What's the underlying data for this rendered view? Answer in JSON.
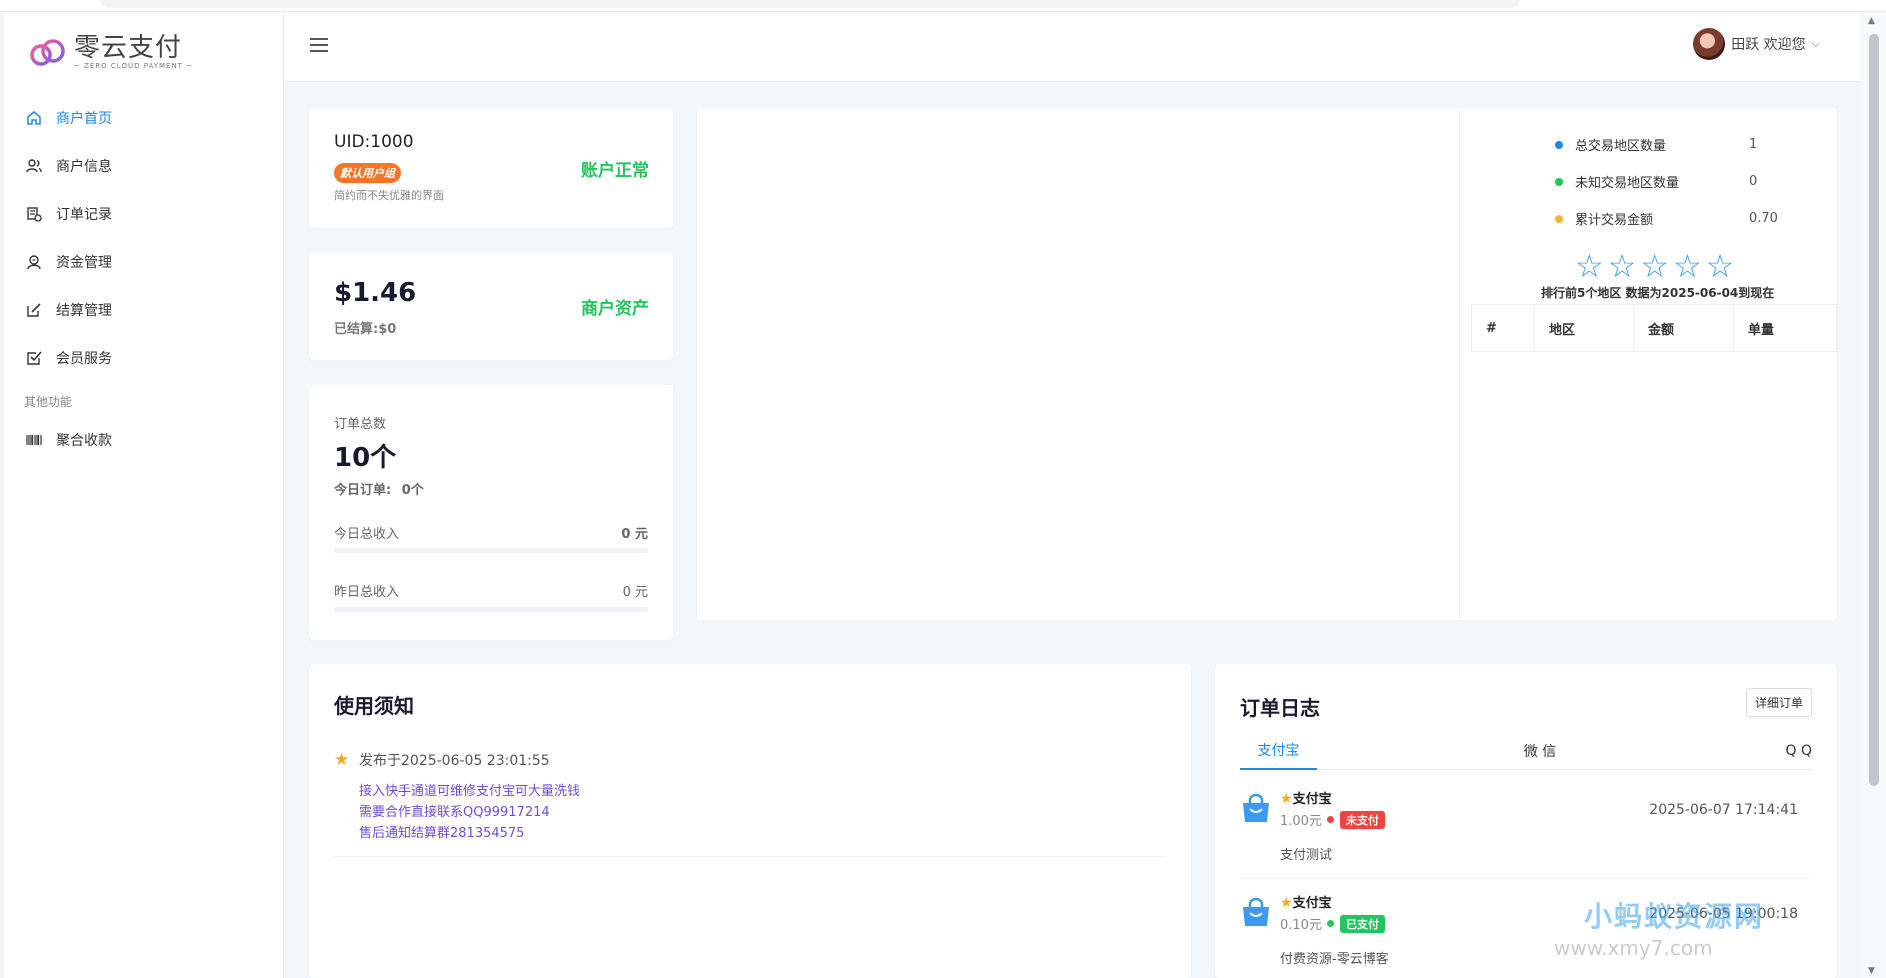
{
  "brand": {
    "title": "零云支付",
    "subtitle": "~ ZERO CLOUD PAYMENT ~"
  },
  "sidebar": {
    "items": [
      {
        "label": "商户首页",
        "icon": "home-icon",
        "active": true
      },
      {
        "label": "商户信息",
        "icon": "users-icon",
        "active": false
      },
      {
        "label": "订单记录",
        "icon": "receipt-icon",
        "active": false
      },
      {
        "label": "资金管理",
        "icon": "wallet-icon",
        "active": false
      },
      {
        "label": "结算管理",
        "icon": "edit-icon",
        "active": false
      },
      {
        "label": "会员服务",
        "icon": "checkbox-icon",
        "active": false
      }
    ],
    "section_title": "其他功能",
    "extra_items": [
      {
        "label": "聚合收款",
        "icon": "barcode-icon"
      }
    ]
  },
  "header": {
    "user_greeting": "田跃 欢迎您"
  },
  "account": {
    "uid": "UID:1000",
    "group_badge": "默认用户组",
    "slogan": "简约而不失优雅的界面",
    "status": "账户正常"
  },
  "assets": {
    "amount": "$1.46",
    "settled": "已结算:$0",
    "label": "商户资产"
  },
  "orders": {
    "label": "订单总数",
    "total": "10个",
    "today_label": "今日订单:",
    "today_value": "0个",
    "today_income_label": "今日总收入",
    "today_income_value": "0 元",
    "yesterday_income_label": "昨日总收入",
    "yesterday_income_value": "0 元",
    "today_income_progress": 0,
    "yesterday_income_progress": 0
  },
  "region_stats": {
    "rows": [
      {
        "label": "总交易地区数量",
        "value": "1",
        "color": "#1e88e5"
      },
      {
        "label": "未知交易地区数量",
        "value": "0",
        "color": "#22c55e"
      },
      {
        "label": "累计交易金额",
        "value": "0.70",
        "color": "#f5b82e"
      }
    ],
    "stars": 5,
    "caption": "排行前5个地区  数据为2025-06-04到现在",
    "table_headers": [
      "#",
      "地区",
      "金额",
      "单量"
    ]
  },
  "notice": {
    "title": "使用须知",
    "date": "发布于2025-06-05 23:01:55",
    "lines": [
      "接入快手通道可维修支付宝可大量洗钱",
      "需要合作直接联系QQ99917214",
      "售后通知结算群281354575"
    ]
  },
  "order_log": {
    "title": "订单日志",
    "detail_button": "详细订单",
    "tabs": [
      "支付宝",
      "微 信",
      "Q Q"
    ],
    "entries": [
      {
        "name": "支付宝",
        "amount": "1.00元",
        "status": "未支付",
        "status_color": "#ef4444",
        "time": "2025-06-07 17:14:41",
        "desc": "支付测试"
      },
      {
        "name": "支付宝",
        "amount": "0.10元",
        "status": "已支付",
        "status_color": "#22c55e",
        "time": "2025-06-05 19:00:18",
        "desc": "付费资源-零云博客"
      }
    ]
  },
  "watermark": {
    "line1": "小蚂蚁资源网",
    "line2": "www.xmy7.com"
  }
}
